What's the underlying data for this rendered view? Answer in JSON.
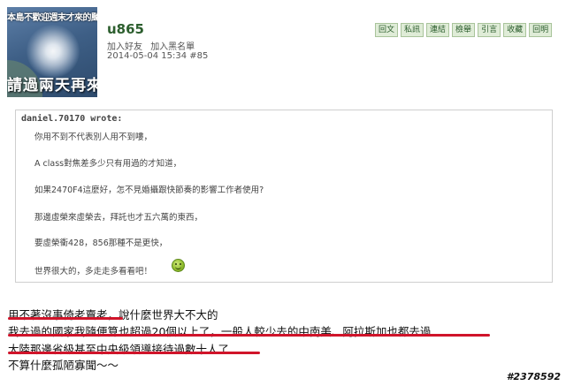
{
  "avatar": {
    "top_text": "本島不歡迎週末才來的颱風",
    "bottom_text": "請過兩天再來"
  },
  "user": {
    "name": "u865",
    "links": [
      "加入好友",
      "加入黑名單"
    ],
    "meta": "2014-05-04 15:34  #85"
  },
  "actions": [
    "回文",
    "私訊",
    "連結",
    "檢舉",
    "引言",
    "收藏",
    "回明"
  ],
  "quote": {
    "author": "daniel.70170 wrote:",
    "lines": [
      "你用不到不代表別人用不到嘍，",
      "A class對焦差多少只有用過的才知道，",
      "如果2470F4這麼好，怎不見婚攝跟快節奏的影響工作者使用?",
      "那邊虛榮來虛榮去，拜託也才五六萬的東西，",
      "要虛榮衝428，856那種不是更快，",
      "世界很大的，多走走多看看吧！"
    ]
  },
  "reply": {
    "lines": [
      "用不著沒事倚老賣老，說什麼世界大不大的",
      "我去過的國家我隨便算也超過20個以上了，一般人較少去的中南美、阿拉斯加也都去過",
      "大陸那邊省級甚至中央級領導接待過數十人了",
      "不算什麼孤陋寡聞～～"
    ]
  },
  "watermark": "#2378592",
  "colors": {
    "accent": "#2c5e2e",
    "button_bg": "#dfecd7",
    "underline": "#d0142a"
  }
}
